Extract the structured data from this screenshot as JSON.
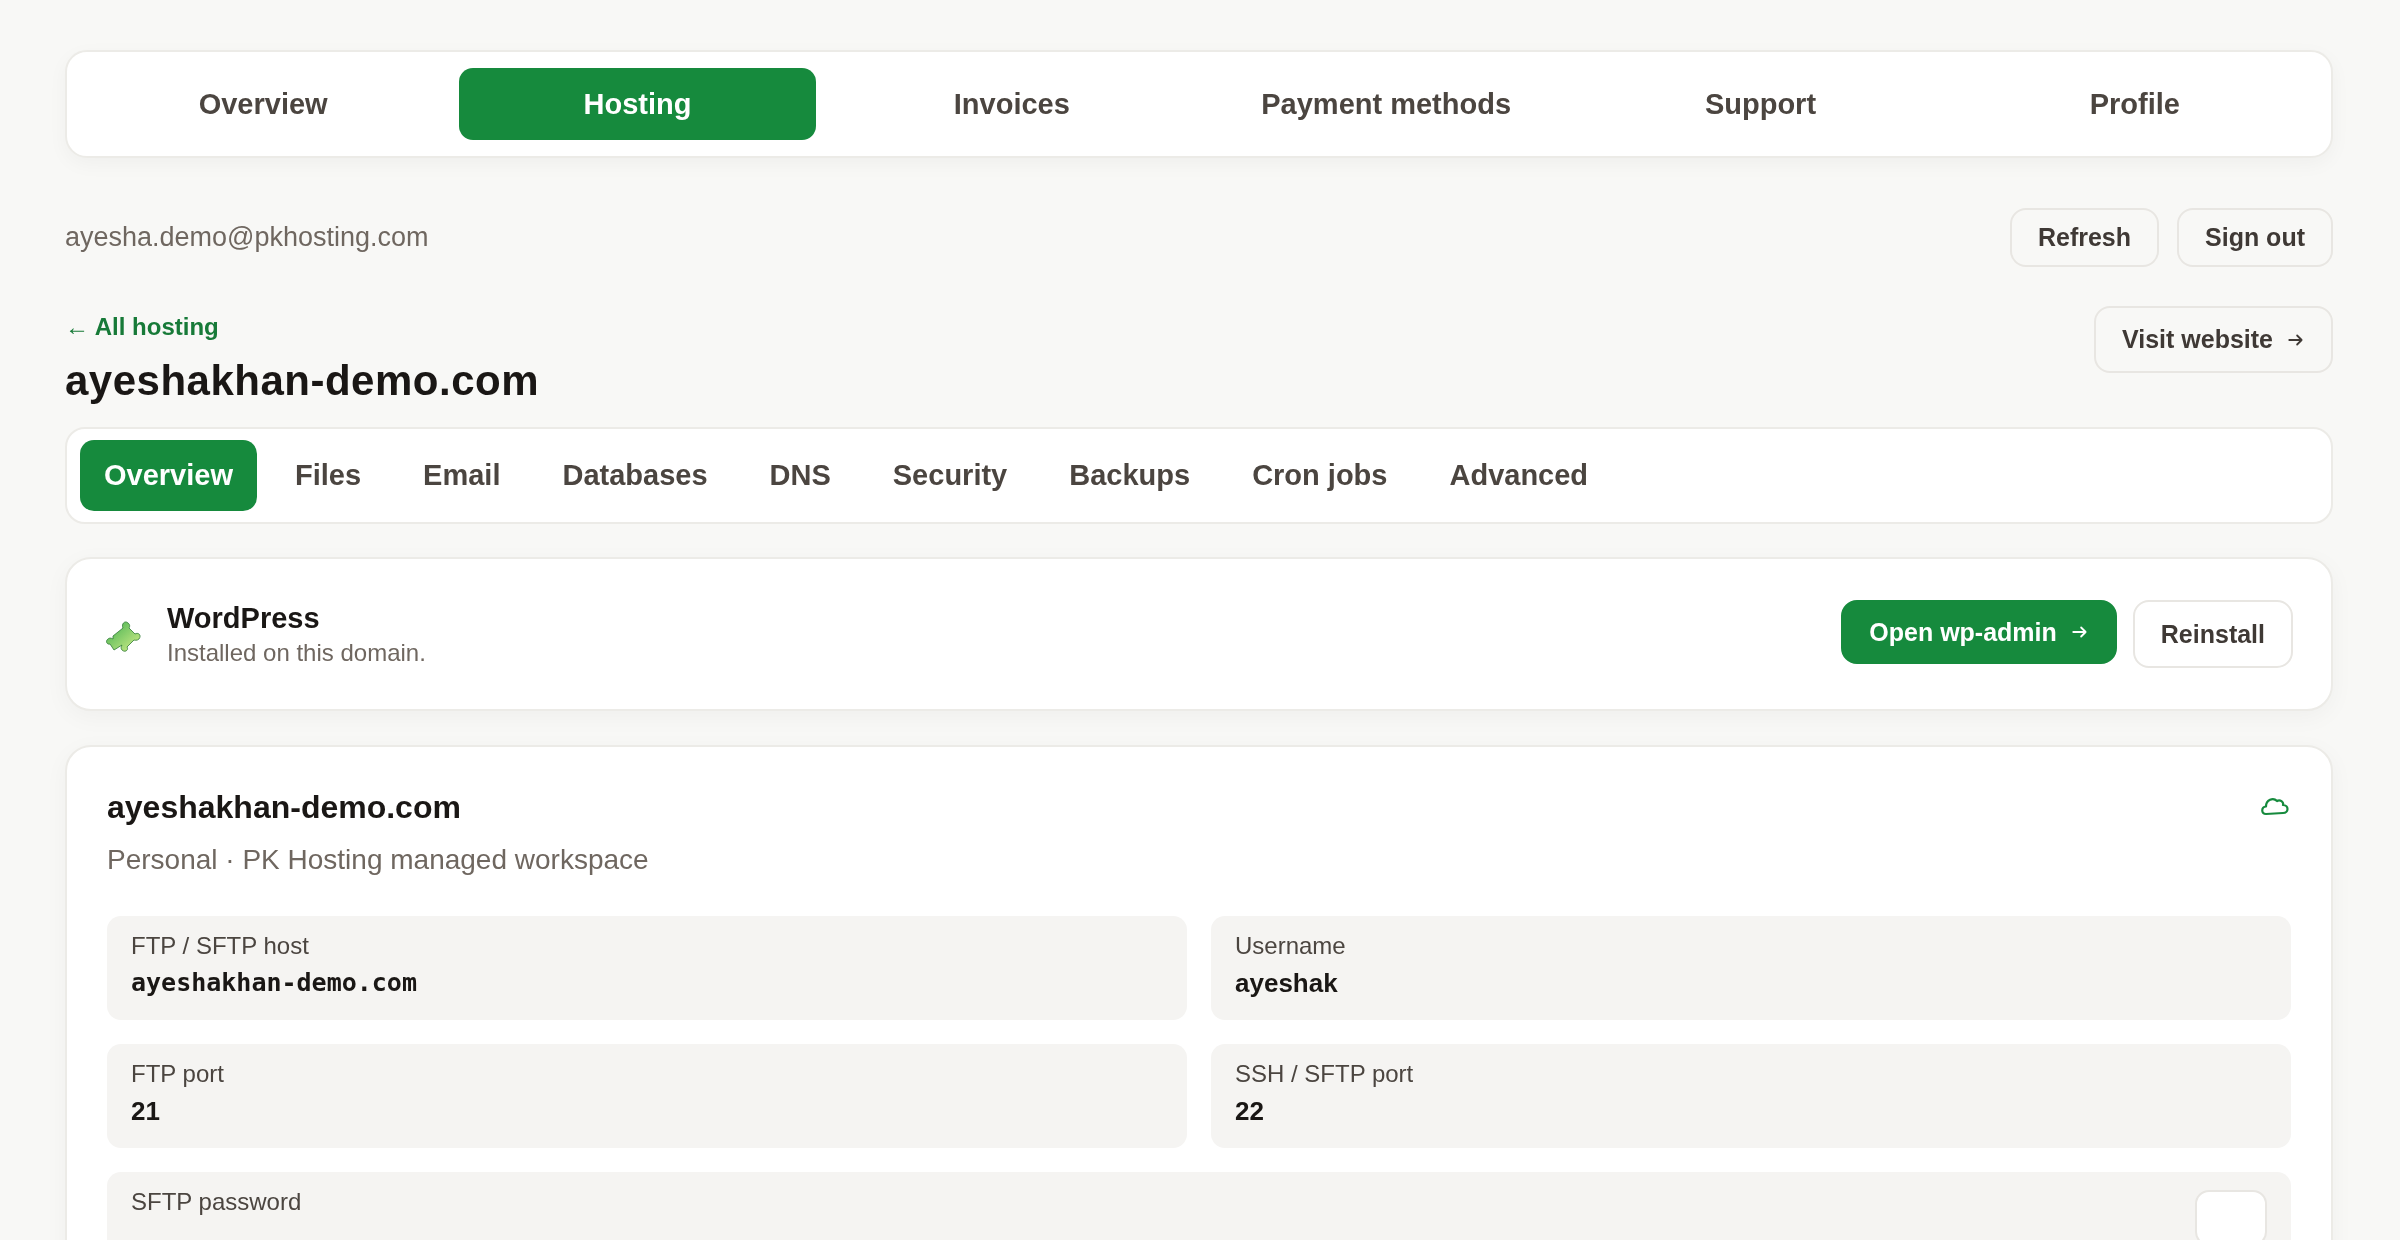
{
  "top_nav": [
    {
      "label": "Overview",
      "selected": false
    },
    {
      "label": "Hosting",
      "selected": true
    },
    {
      "label": "Invoices",
      "selected": false
    },
    {
      "label": "Payment methods",
      "selected": false
    },
    {
      "label": "Support",
      "selected": false
    },
    {
      "label": "Profile",
      "selected": false
    }
  ],
  "account": {
    "email": "ayesha.demo@pkhosting.com",
    "buttons": [
      "Refresh",
      "Sign out"
    ]
  },
  "header": {
    "back_link": "← All hosting",
    "title": "ayeshakhan-demo.com",
    "visit_button": "Visit website"
  },
  "sub_tabs": [
    {
      "label": "Overview",
      "selected": true
    },
    {
      "label": "Files",
      "selected": false
    },
    {
      "label": "Email",
      "selected": false
    },
    {
      "label": "Databases",
      "selected": false
    },
    {
      "label": "DNS",
      "selected": false
    },
    {
      "label": "Security",
      "selected": false
    },
    {
      "label": "Backups",
      "selected": false
    },
    {
      "label": "Cron jobs",
      "selected": false
    },
    {
      "label": "Advanced",
      "selected": false
    }
  ],
  "app_card": {
    "name": "WordPress",
    "status": "Installed on this domain.",
    "primary_button": "Open wp-admin",
    "secondary_button": "Reinstall"
  },
  "site_card": {
    "title": "ayeshakhan-demo.com",
    "subtitle": "Personal · PK Hosting managed workspace",
    "fields": [
      {
        "label": "FTP / SFTP host",
        "value": "ayeshakhan-demo.com",
        "kind": "mono"
      },
      {
        "label": "Username",
        "value": "ayeshak",
        "kind": "text"
      },
      {
        "label": "FTP port",
        "value": "21",
        "kind": "text"
      },
      {
        "label": "SSH / SFTP port",
        "value": "22",
        "kind": "text"
      },
      {
        "label": "SFTP password",
        "kind": "action"
      }
    ]
  }
}
